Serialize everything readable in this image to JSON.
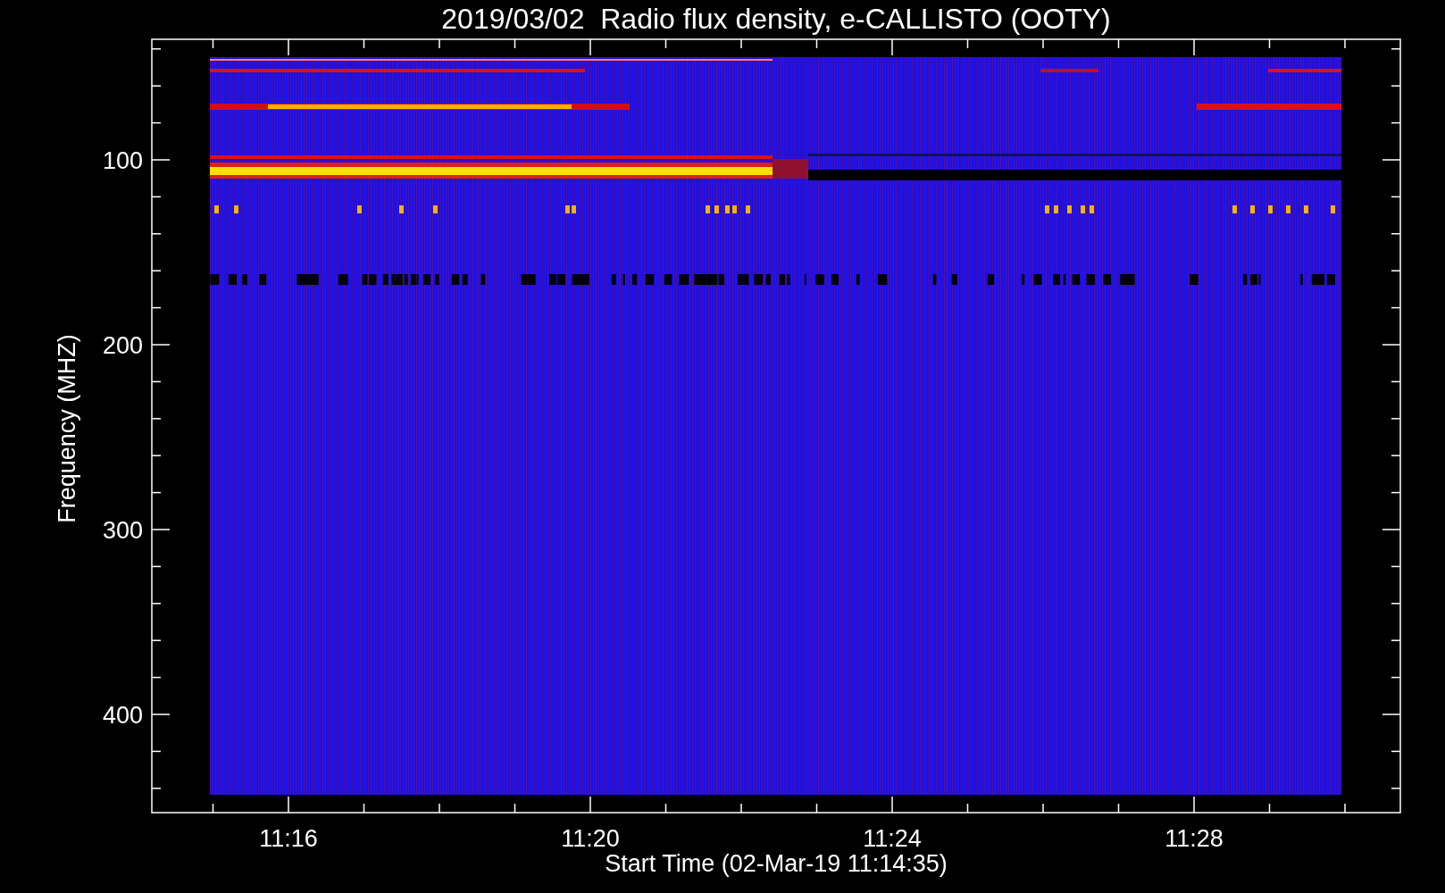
{
  "title": "2019/03/02  Radio flux density, e-CALLISTO (OOTY)",
  "y_axis": {
    "label": "Frequency (MHZ)",
    "ticks": [
      "100",
      "200",
      "300",
      "400"
    ]
  },
  "x_axis": {
    "label": "Start Time (02-Mar-19 11:14:35)",
    "ticks": [
      "11:16",
      "11:20",
      "11:24",
      "11:28"
    ]
  }
}
